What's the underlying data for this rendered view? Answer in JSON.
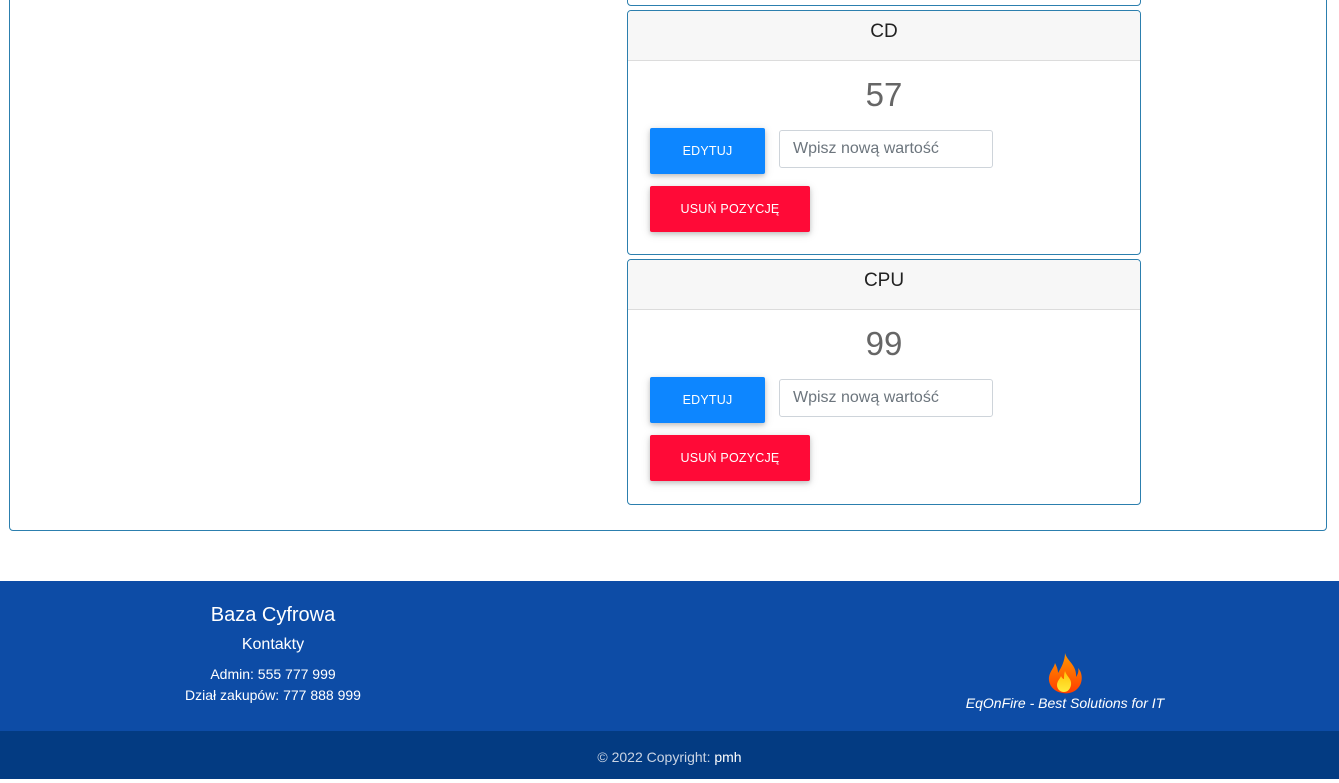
{
  "cards": [
    {
      "title": "CD",
      "value": "57",
      "edit_label": "EDYTUJ",
      "input_placeholder": "Wpisz nową wartość",
      "delete_label": "USUŃ POZYCJĘ"
    },
    {
      "title": "CPU",
      "value": "99",
      "edit_label": "EDYTUJ",
      "input_placeholder": "Wpisz nową wartość",
      "delete_label": "USUŃ POZYCJĘ"
    }
  ],
  "footer": {
    "title": "Baza Cyfrowa",
    "subtitle": "Kontakty",
    "admin_line": "Admin: 555 777 999",
    "purchase_line": "Dział zakupów: 777 888 999",
    "logo_icon": "flame-icon",
    "slogan": "EqOnFire - Best Solutions for IT",
    "copyright_prefix": "© 2022 Copyright: ",
    "copyright_brand": "pmh",
    "colors": {
      "footer_bg": "#0d4ca6",
      "copyright_bg": "#033b82"
    }
  },
  "colors": {
    "edit_button": "#0d86ff",
    "delete_button": "#ff0a37",
    "card_border": "#2c7fae"
  }
}
